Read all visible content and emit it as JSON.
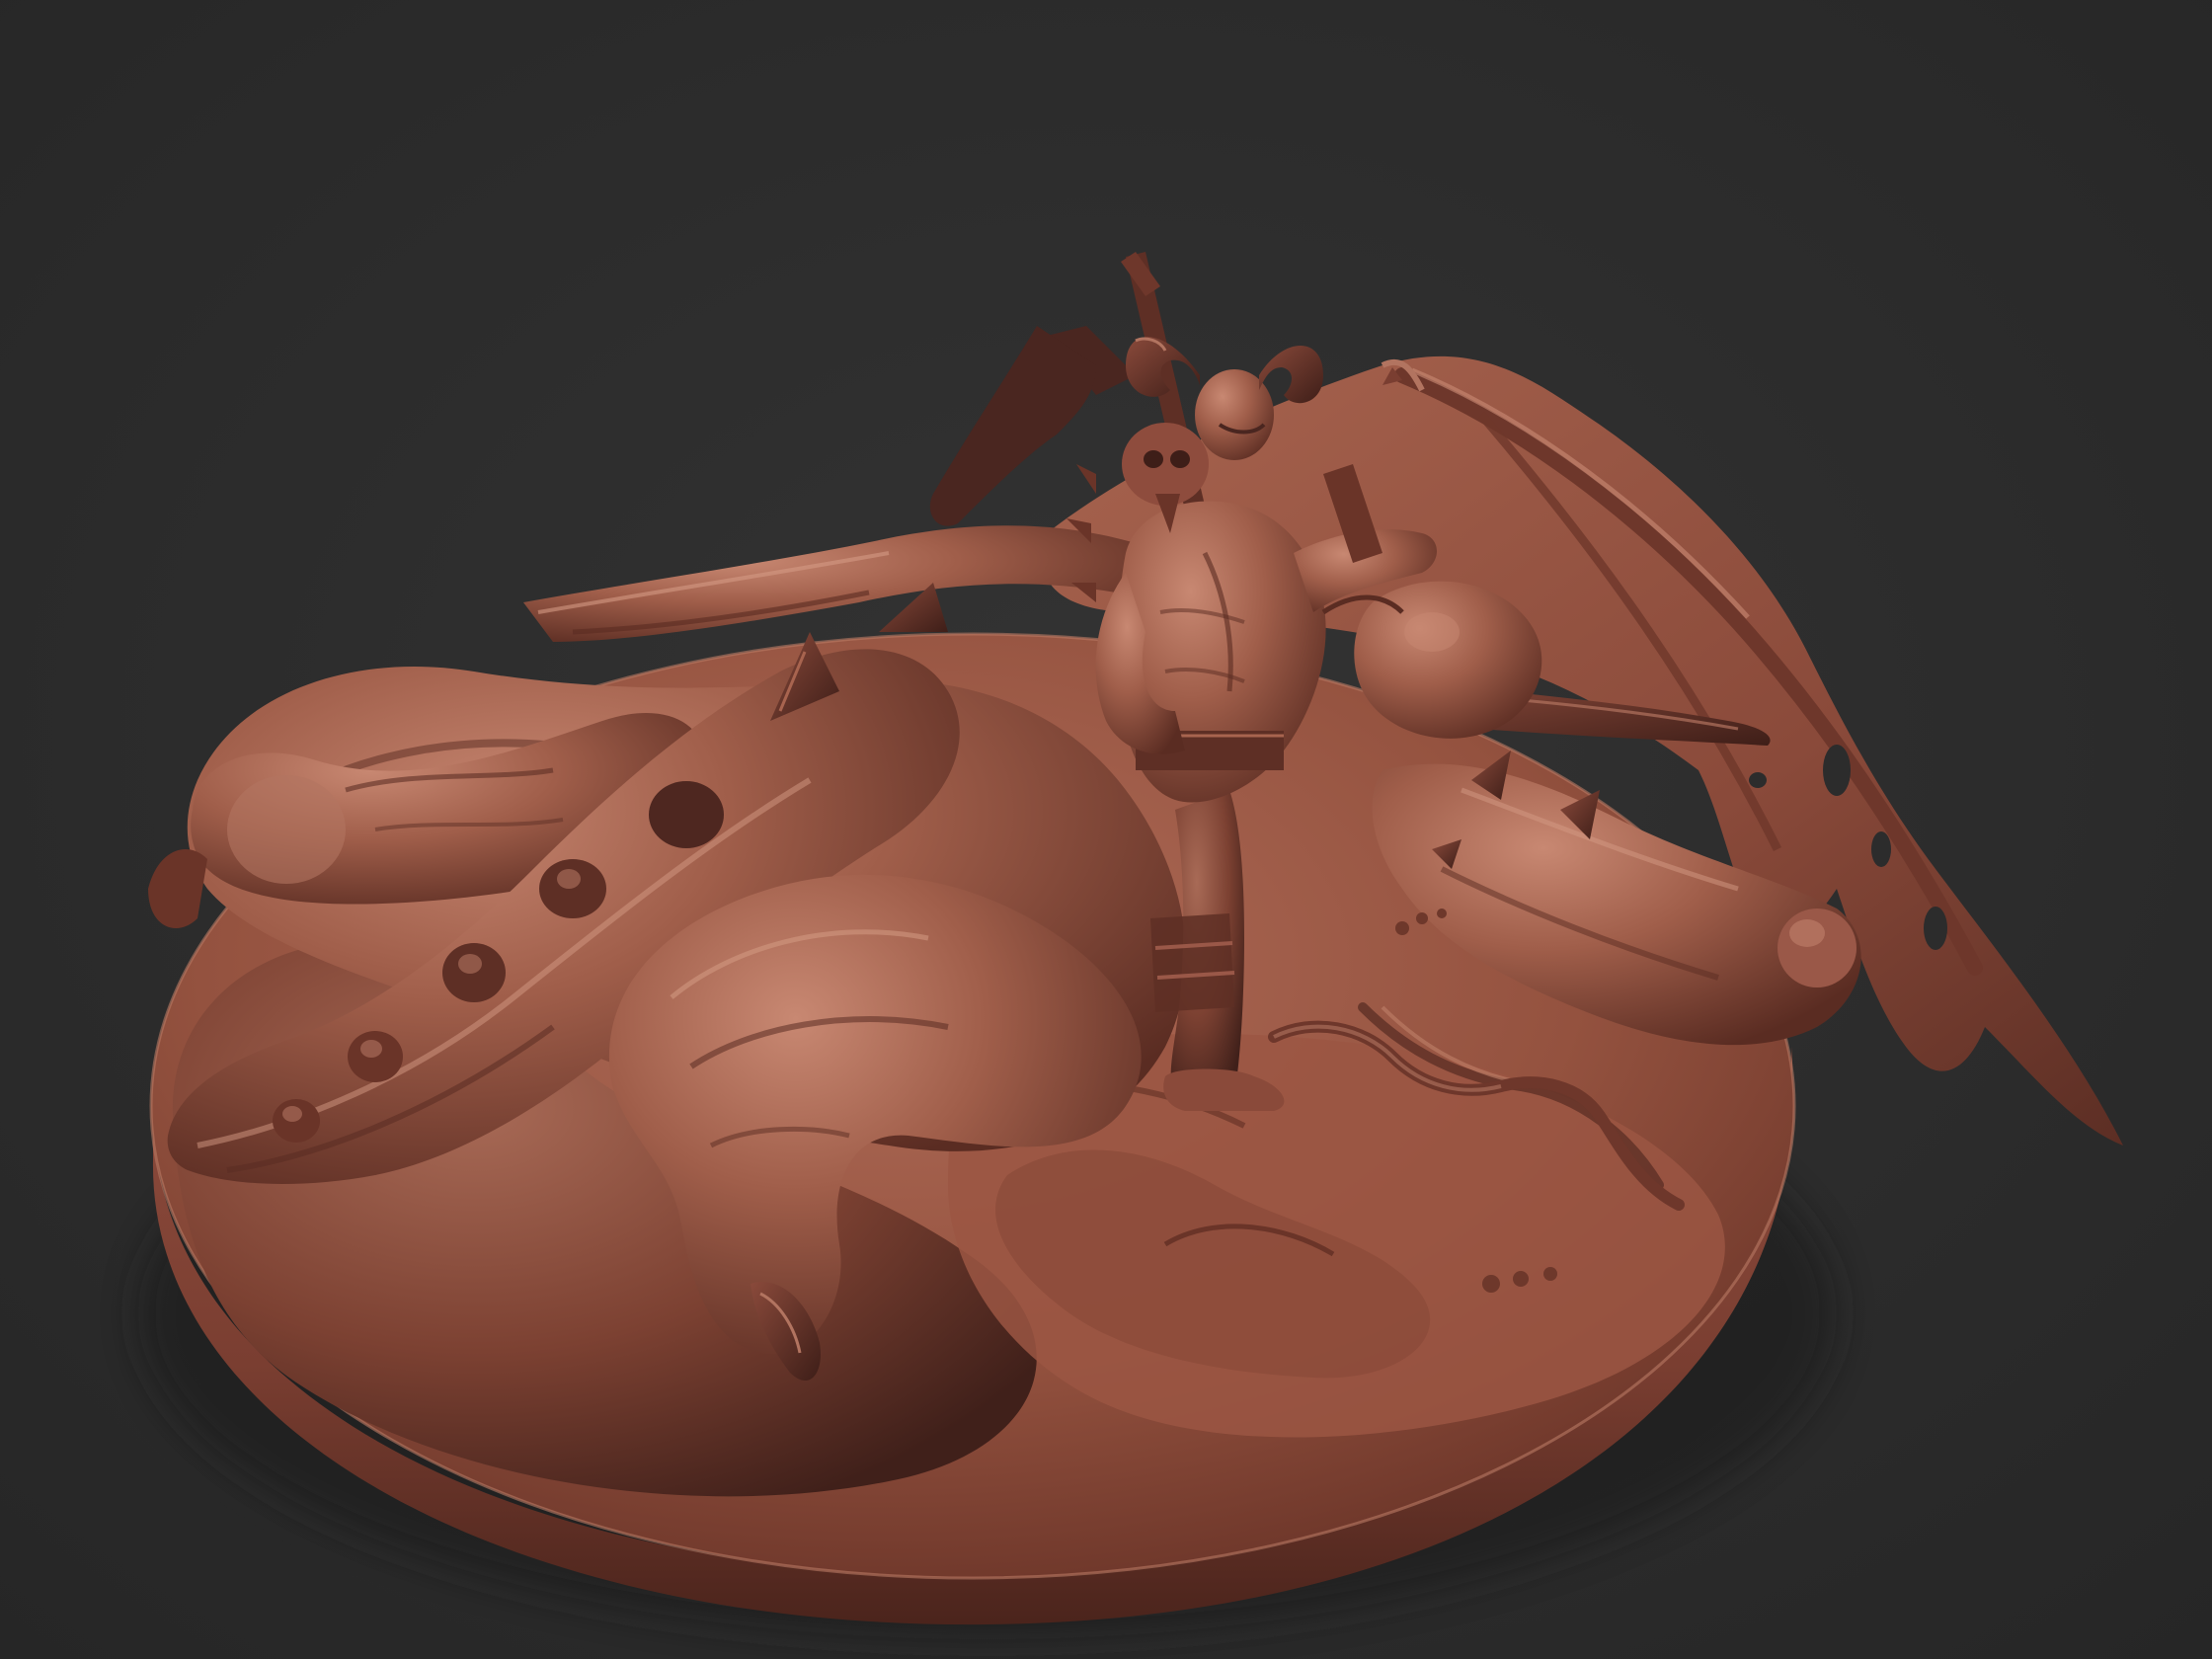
{
  "viewport": {
    "background_color": "#2c2c2c",
    "material_color": "#9a5848",
    "material_highlight": "#c98a74",
    "material_shadow": "#4a2620",
    "light_direction": "top-left"
  },
  "scene": {
    "subject": "sculpt-render",
    "elements": [
      "base-disc",
      "dragon-carcass",
      "dragon-wing",
      "dragon-claw",
      "spiked-tail",
      "horned-warrior",
      "banner-pole"
    ]
  }
}
